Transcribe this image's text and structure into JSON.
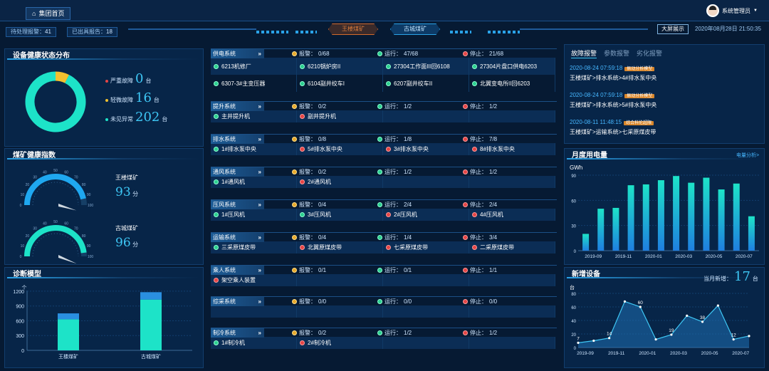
{
  "header": {
    "home_tab": "集团首页",
    "user": "系统管理员",
    "pending_alarms_label": "待处理报警：",
    "pending_alarms_value": "41",
    "reports_label": "已出具报告：",
    "reports_value": "18",
    "mine_tabs": [
      "王楼煤矿",
      "古城煤矿"
    ],
    "bigscreen_button": "大屏展示",
    "datetime": "2020年08月28日 21:50:35"
  },
  "health": {
    "title": "设备健康状态分布",
    "legend": [
      {
        "label": "严重故障",
        "value": "0",
        "unit": "台",
        "color": "#e54545"
      },
      {
        "label": "轻微故障",
        "value": "16",
        "unit": "台",
        "color": "#f2c02e"
      },
      {
        "label": "未见异常",
        "value": "202",
        "unit": "台",
        "color": "#1de3c8"
      }
    ],
    "donut": {
      "serious": 0,
      "minor": 16,
      "normal": 202
    }
  },
  "index": {
    "title": "煤矿健康指数",
    "gauges": [
      {
        "name": "王楼煤矿",
        "score": "93",
        "unit": "分",
        "value": 93,
        "color": "#1fa8f0"
      },
      {
        "name": "古城煤矿",
        "score": "96",
        "unit": "分",
        "value": 96,
        "color": "#1de3c8"
      }
    ],
    "ticks": [
      "0",
      "10",
      "20",
      "30",
      "40",
      "50",
      "60",
      "70",
      "80",
      "90",
      "100"
    ]
  },
  "diagnosis": {
    "title": "诊断模型",
    "chart_data": {
      "type": "bar",
      "categories": [
        "王楼煤矿",
        "古城煤矿"
      ],
      "series": [
        {
          "values": [
            630,
            1030
          ],
          "color": "#1de3c8"
        },
        {
          "values": [
            120,
            150
          ],
          "color": "#2a8fe0"
        }
      ],
      "yticks": [
        "0",
        "300",
        "600",
        "900",
        "1200"
      ],
      "ylim": [
        0,
        1300
      ]
    },
    "axis_label": "个"
  },
  "systems": [
    {
      "name": "供电系统",
      "alarm": "0/68",
      "run": "47/68",
      "stop": "21/68",
      "devices": [
        {
          "name": "6213机修厂",
          "status": "green"
        },
        {
          "name": "6210锅炉房II",
          "status": "green"
        },
        {
          "name": "27304工作面III回6108",
          "status": "green"
        },
        {
          "name": "27304片盘口供电6203",
          "status": "green"
        },
        {
          "name": "6307-3#主变压器",
          "status": "green"
        },
        {
          "name": "6104副井绞车I",
          "status": "green"
        },
        {
          "name": "6207副井绞车II",
          "status": "green"
        },
        {
          "name": "北翼变电所II回6203",
          "status": "green"
        }
      ]
    },
    {
      "name": "提升系统",
      "alarm": "0/2",
      "run": "1/2",
      "stop": "1/2",
      "devices": [
        {
          "name": "主井提升机",
          "status": "green"
        },
        {
          "name": "副井提升机",
          "status": "red"
        }
      ]
    },
    {
      "name": "排水系统",
      "alarm": "0/8",
      "run": "1/8",
      "stop": "7/8",
      "devices": [
        {
          "name": "1#排水泵中央",
          "status": "green"
        },
        {
          "name": "5#排水泵中央",
          "status": "red"
        },
        {
          "name": "3#排水泵中央",
          "status": "red"
        },
        {
          "name": "8#排水泵中央",
          "status": "red"
        }
      ]
    },
    {
      "name": "通风系统",
      "alarm": "0/2",
      "run": "1/2",
      "stop": "1/2",
      "devices": [
        {
          "name": "1#通风机",
          "status": "green"
        },
        {
          "name": "2#通风机",
          "status": "red"
        }
      ]
    },
    {
      "name": "压风系统",
      "alarm": "0/4",
      "run": "2/4",
      "stop": "2/4",
      "devices": [
        {
          "name": "1#压风机",
          "status": "green"
        },
        {
          "name": "3#压风机",
          "status": "green"
        },
        {
          "name": "2#压风机",
          "status": "red"
        },
        {
          "name": "4#压风机",
          "status": "red"
        }
      ]
    },
    {
      "name": "运输系统",
      "alarm": "0/4",
      "run": "1/4",
      "stop": "3/4",
      "devices": [
        {
          "name": "三采原煤皮带",
          "status": "green"
        },
        {
          "name": "北翼原煤皮带",
          "status": "red"
        },
        {
          "name": "七采原煤皮带",
          "status": "red"
        },
        {
          "name": "二采原煤皮带",
          "status": "red"
        }
      ]
    },
    {
      "name": "乘人系统",
      "alarm": "0/1",
      "run": "0/1",
      "stop": "1/1",
      "devices": [
        {
          "name": "架空乘人装置",
          "status": "red"
        }
      ]
    },
    {
      "name": "综采系统",
      "alarm": "0/0",
      "run": "0/0",
      "stop": "0/0",
      "devices": []
    },
    {
      "name": "制冷系统",
      "alarm": "0/2",
      "run": "1/2",
      "stop": "1/2",
      "devices": [
        {
          "name": "1#制冷机",
          "status": "green"
        },
        {
          "name": "2#制冷机",
          "status": "red"
        }
      ]
    }
  ],
  "labels": {
    "alarm": "报警：",
    "run": "运行：",
    "stop": "停止："
  },
  "alarms": {
    "tabs": [
      "故障报警",
      "参数报警",
      "劣化报警"
    ],
    "items": [
      {
        "time": "2020-08-24 07:59:18",
        "badge": "振动分析模型",
        "path": "王楼煤矿>排水系统>4#排水泵中央"
      },
      {
        "time": "2020-08-24 07:59:18",
        "badge": "振动分析模型",
        "path": "王楼煤矿>排水系统>5#排水泵中央"
      },
      {
        "time": "2020-08-11 11:48:15",
        "badge": "综合科伦超限",
        "path": "王楼煤矿>运输系统>七采原煤皮带"
      }
    ]
  },
  "power": {
    "title": "月度用电量",
    "link": "电量分析>",
    "chart_data": {
      "type": "bar",
      "ylabel": "GWh",
      "ylim": [
        0,
        90
      ],
      "yticks": [
        "0",
        "30",
        "60",
        "90"
      ],
      "categories": [
        "2019-09",
        "2019-10",
        "2019-11",
        "2019-12",
        "2020-01",
        "2020-02",
        "2020-03",
        "2020-04",
        "2020-05",
        "2020-06",
        "2020-07",
        "2020-08"
      ],
      "xlabels": [
        "2019-09",
        "2019-11",
        "2020-01",
        "2020-03",
        "2020-05",
        "2020-07"
      ],
      "values": [
        20,
        50,
        51,
        78,
        79,
        84,
        89,
        81,
        87,
        73,
        80,
        41
      ]
    }
  },
  "newdev": {
    "title": "新增设备",
    "month_label": "当月新增：",
    "month_value": "17",
    "month_unit": "台",
    "axis_unit": "台",
    "chart_data": {
      "type": "area",
      "ylim": [
        0,
        80
      ],
      "yticks": [
        "0",
        "20",
        "40",
        "60",
        "80"
      ],
      "categories": [
        "2019-09",
        "2019-10",
        "2019-11",
        "2019-12",
        "2020-01",
        "2020-02",
        "2020-03",
        "2020-04",
        "2020-05",
        "2020-06",
        "2020-07",
        "2020-08"
      ],
      "xlabels": [
        "2019-09",
        "2019-11",
        "2020-01",
        "2020-03",
        "2020-05",
        "2020-07"
      ],
      "values": [
        7,
        10,
        14,
        68,
        60,
        12,
        19,
        47,
        38,
        62,
        12,
        17
      ],
      "labels": [
        {
          "i": 0,
          "t": "7"
        },
        {
          "i": 2,
          "t": "14"
        },
        {
          "i": 4,
          "t": "60"
        },
        {
          "i": 6,
          "t": "19"
        },
        {
          "i": 8,
          "t": "38"
        },
        {
          "i": 10,
          "t": "12"
        }
      ]
    }
  }
}
